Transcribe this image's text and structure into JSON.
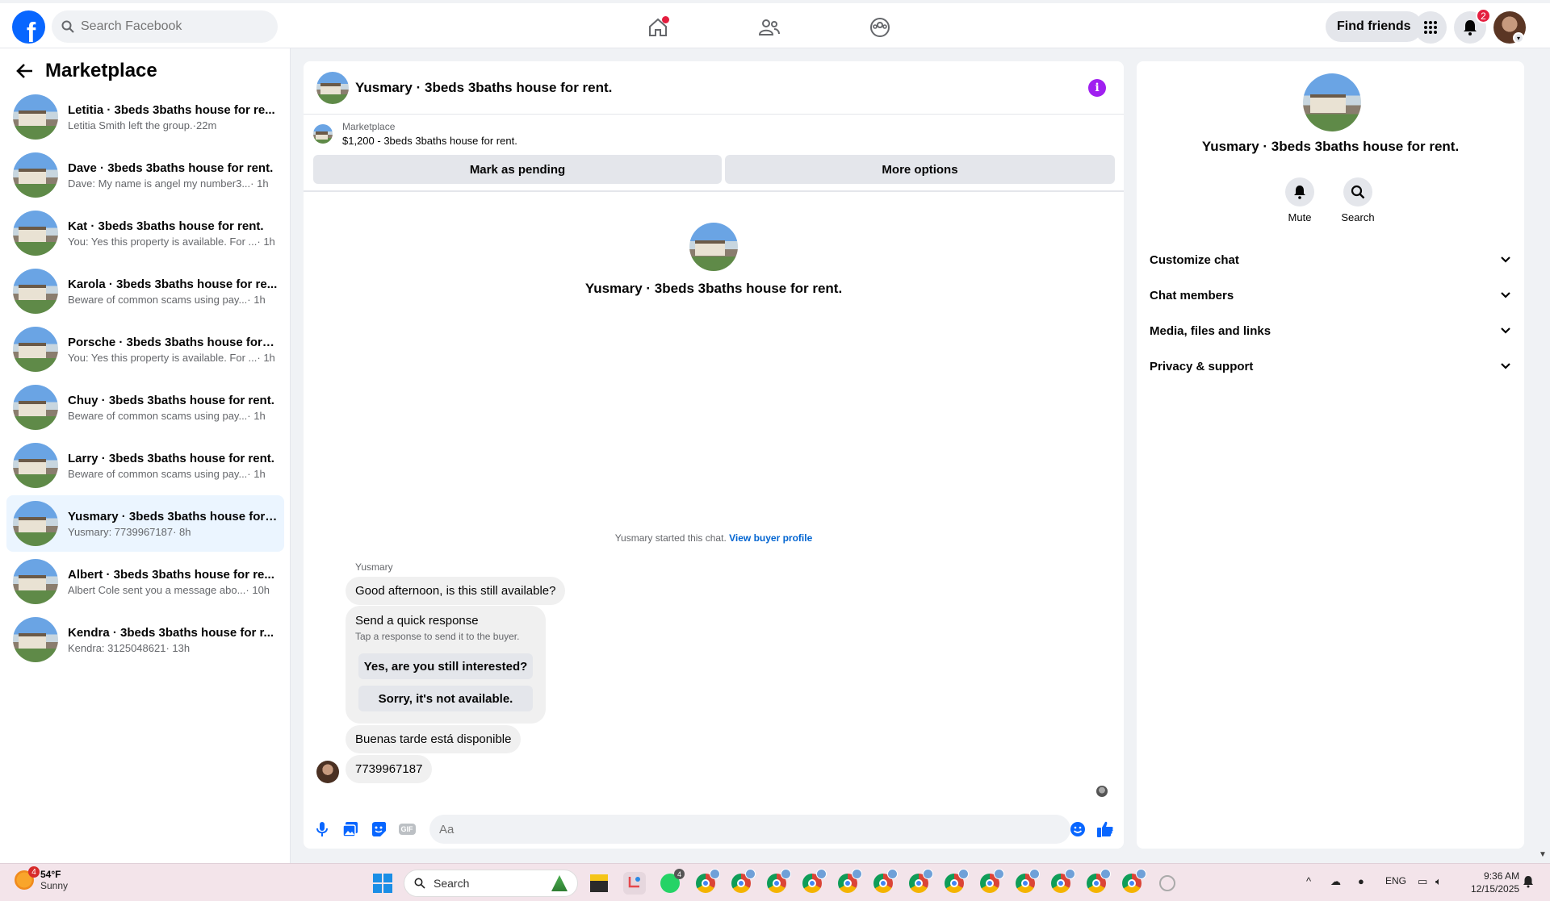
{
  "header": {
    "search_placeholder": "Search Facebook",
    "find_friends_label": "Find friends",
    "notification_count": "2"
  },
  "sidebar": {
    "title": "Marketplace",
    "conversations": [
      {
        "name": "Letitia · 3beds 3baths house for re...",
        "preview": "Letitia Smith left the group.",
        "time": "·22m"
      },
      {
        "name": "Dave · 3beds 3baths house for rent.",
        "preview": "Dave: My name is angel my number3...",
        "time": "· 1h"
      },
      {
        "name": "Kat · 3beds 3baths house for rent.",
        "preview": "You: Yes this property is available. For ...",
        "time": "· 1h"
      },
      {
        "name": "Karola · 3beds 3baths house for re...",
        "preview": "Beware of common scams using pay...",
        "time": "· 1h"
      },
      {
        "name": "Porsche · 3beds 3baths house for r...",
        "preview": "You: Yes this property is available. For ...",
        "time": "· 1h"
      },
      {
        "name": "Chuy · 3beds 3baths house for rent.",
        "preview": "Beware of common scams using pay...",
        "time": "· 1h"
      },
      {
        "name": "Larry · 3beds 3baths house for rent.",
        "preview": "Beware of common scams using pay...",
        "time": "· 1h"
      },
      {
        "name": "Yusmary · 3beds 3baths house for ...",
        "preview": "Yusmary: 7739967187",
        "time": "· 8h"
      },
      {
        "name": "Albert · 3beds 3baths house for re...",
        "preview": "Albert Cole sent you a message abo...",
        "time": "· 10h"
      },
      {
        "name": "Kendra · 3beds 3baths house for r...",
        "preview": "Kendra: 3125048621",
        "time": "· 13h"
      }
    ]
  },
  "chat": {
    "title": "Yusmary · 3beds 3baths house for rent.",
    "listing_label": "Marketplace",
    "listing_price": "$1,200 - 3beds 3baths house for rent.",
    "mark_pending_label": "Mark as pending",
    "more_options_label": "More options",
    "profile_name": "Yusmary · 3beds 3baths house for rent.",
    "started_text": "Yusmary started this chat.",
    "buyer_profile_link": "View buyer profile",
    "sender_name": "Yusmary",
    "msg1": "Good afternoon, is this still available?",
    "quick_title": "Send a quick response",
    "quick_sub": "Tap a response to send it to the buyer.",
    "quick_reply1": "Yes, are you still interested?",
    "quick_reply2": "Sorry, it's not available.",
    "msg2": "Buenas tarde está disponible",
    "msg3": "7739967187",
    "composer_placeholder": "Aa",
    "gif_label": "GIF"
  },
  "details": {
    "name": "Yusmary · 3beds 3baths house for rent.",
    "mute_label": "Mute",
    "search_label": "Search",
    "sections": [
      "Customize chat",
      "Chat members",
      "Media, files and links",
      "Privacy & support"
    ]
  },
  "taskbar": {
    "weather_badge": "4",
    "temp": "54°F",
    "condition": "Sunny",
    "search_placeholder": "Search",
    "whatsapp_badge": "4",
    "language": "ENG",
    "time": "9:36 AM",
    "date": "12/15/2025"
  }
}
